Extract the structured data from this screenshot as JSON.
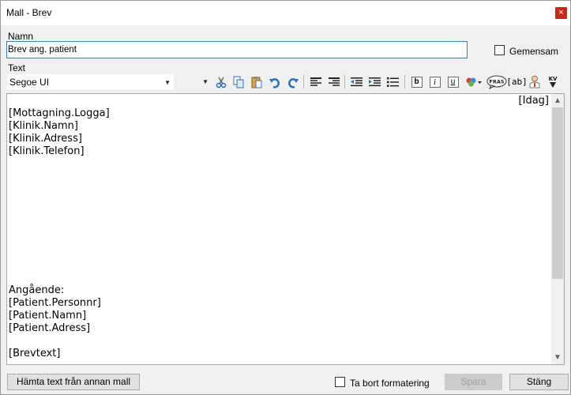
{
  "window": {
    "title": "Mall - Brev",
    "close_label": "×"
  },
  "form": {
    "name_label": "Namn",
    "name_value": "Brev ang. patient",
    "shared_label": "Gemensam",
    "shared_checked": false,
    "text_label": "Text"
  },
  "toolbar": {
    "font_value": "Segoe UI",
    "size_value": "",
    "icons": [
      "cut-icon",
      "copy-icon",
      "paste-icon",
      "undo-icon",
      "redo-icon",
      "align-left-icon",
      "align-right-icon",
      "outdent-icon",
      "indent-icon",
      "bullet-list-icon",
      "bold-icon",
      "italic-icon",
      "underline-icon",
      "color-icon",
      "phrase-icon",
      "field-icon",
      "doctor-icon",
      "kv-icon"
    ],
    "bold_label": "b",
    "italic_label": "i",
    "underline_label": "u",
    "phrase_label": "FRAS",
    "field_label": "[ab]",
    "kv_label": "KV"
  },
  "editor": {
    "date_field": "[Idag]",
    "lines": [
      "[Mottagning.Logga]",
      "[Klinik.Namn]",
      "[Klinik.Adress]",
      "[Klinik.Telefon]",
      "",
      "",
      "",
      "",
      "",
      "",
      "",
      "",
      "",
      "",
      "Angående:",
      "[Patient.Personnr]",
      "[Patient.Namn]",
      "[Patient.Adress]",
      "",
      "[Brevtext]"
    ]
  },
  "footer": {
    "fetch_button": "Hämta text från annan mall",
    "remove_format_label": "Ta bort formatering",
    "remove_format_checked": false,
    "save_button": "Spara",
    "close_button": "Stäng"
  }
}
